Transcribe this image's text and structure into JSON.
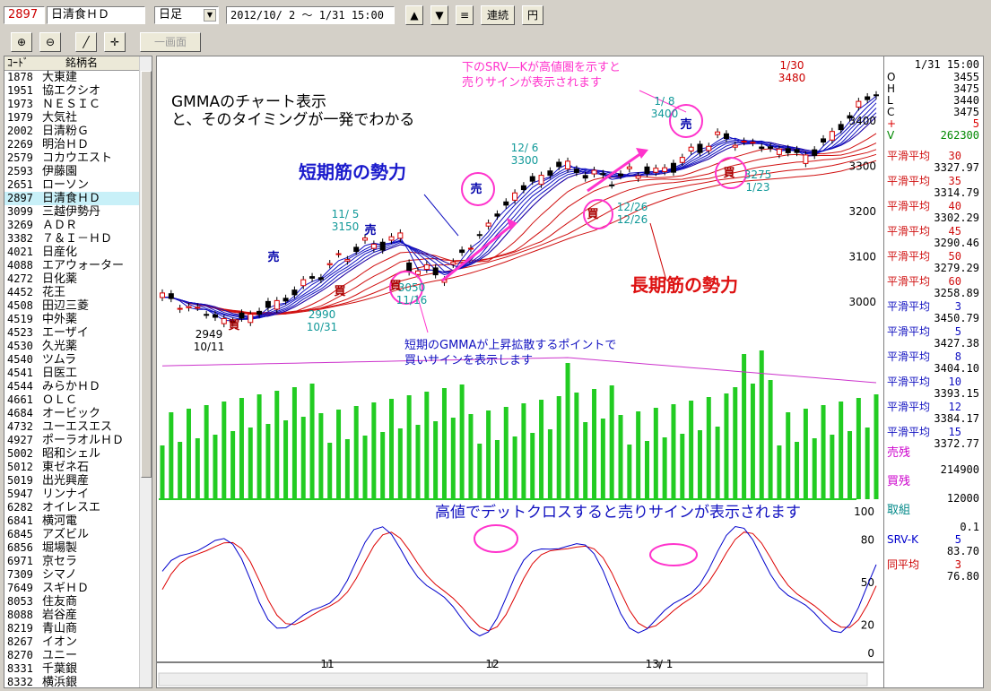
{
  "toolbar": {
    "code": "2897",
    "name": "日清食ＨＤ",
    "period": "日足",
    "range": "2012/10/ 2 ～  1/31 15:00",
    "continuous": "連続",
    "yen": "円",
    "single_screen": "一画面"
  },
  "list": {
    "col_code": "ｺｰﾄﾞ",
    "col_name": "銘柄名",
    "rows": [
      {
        "code": "1878",
        "name": "大東建"
      },
      {
        "code": "1951",
        "name": "協エクシオ"
      },
      {
        "code": "1973",
        "name": "ＮＥＳＩＣ"
      },
      {
        "code": "1979",
        "name": "大気社"
      },
      {
        "code": "2002",
        "name": "日清粉Ｇ"
      },
      {
        "code": "2269",
        "name": "明治ＨＤ"
      },
      {
        "code": "2579",
        "name": "コカウエスト"
      },
      {
        "code": "2593",
        "name": "伊藤園"
      },
      {
        "code": "2651",
        "name": "ローソン"
      },
      {
        "code": "2897",
        "name": "日清食ＨＤ"
      },
      {
        "code": "3099",
        "name": "三越伊勢丹"
      },
      {
        "code": "3269",
        "name": "ＡＤＲ"
      },
      {
        "code": "3382",
        "name": "７＆Ｉ－ＨＤ"
      },
      {
        "code": "4021",
        "name": "日産化"
      },
      {
        "code": "4088",
        "name": "エアウォーター"
      },
      {
        "code": "4272",
        "name": "日化薬"
      },
      {
        "code": "4452",
        "name": "花王"
      },
      {
        "code": "4508",
        "name": "田辺三菱"
      },
      {
        "code": "4519",
        "name": "中外薬"
      },
      {
        "code": "4523",
        "name": "エーザイ"
      },
      {
        "code": "4530",
        "name": "久光薬"
      },
      {
        "code": "4540",
        "name": "ツムラ"
      },
      {
        "code": "4541",
        "name": "日医工"
      },
      {
        "code": "4544",
        "name": "みらかＨＤ"
      },
      {
        "code": "4661",
        "name": "ＯＬＣ"
      },
      {
        "code": "4684",
        "name": "オービック"
      },
      {
        "code": "4732",
        "name": "ユーエスエス"
      },
      {
        "code": "4927",
        "name": "ポーラオルＨＤ"
      },
      {
        "code": "5002",
        "name": "昭和シェル"
      },
      {
        "code": "5012",
        "name": "東ゼネ石"
      },
      {
        "code": "5019",
        "name": "出光興産"
      },
      {
        "code": "5947",
        "name": "リンナイ"
      },
      {
        "code": "6282",
        "name": "オイレスエ"
      },
      {
        "code": "6841",
        "name": "横河電"
      },
      {
        "code": "6845",
        "name": "アズビル"
      },
      {
        "code": "6856",
        "name": "堀場製"
      },
      {
        "code": "6971",
        "name": "京セラ"
      },
      {
        "code": "7309",
        "name": "シマノ"
      },
      {
        "code": "7649",
        "name": "スギＨＤ"
      },
      {
        "code": "8053",
        "name": "住友商"
      },
      {
        "code": "8088",
        "name": "岩谷産"
      },
      {
        "code": "8219",
        "name": "青山商"
      },
      {
        "code": "8267",
        "name": "イオン"
      },
      {
        "code": "8270",
        "name": "ユニー"
      },
      {
        "code": "8331",
        "name": "千葉銀"
      },
      {
        "code": "8332",
        "name": "横浜銀"
      }
    ]
  },
  "chart": {
    "headline_1": "GMMAのチャート表示",
    "headline_2": "と、そのタイミングが一発でわかる",
    "short_label": "短期筋の勢力",
    "long_label": "長期筋の勢力",
    "note_top_1": "下のSRV―Kが高値圏を示すと",
    "note_top_2": "売りサインが表示されます",
    "note_mid_1": "短期のGMMAが上昇拡散するポイントで",
    "note_mid_2": "買いサインを表示します",
    "note_bottom": "高値でデットクロスすると売りサインが表示されます",
    "sell": "売",
    "buy": "買",
    "ann_0131_date": "1/30",
    "ann_0131_val": "3480",
    "ann_18_date": "1/ 8",
    "ann_18_val": "3400",
    "ann_1206_date": "12/ 6",
    "ann_1206_val": "3300",
    "ann_1105_date": "11/ 5",
    "ann_1105_val": "3150",
    "ann_1031_val": "2990",
    "ann_1031_date": "10/31",
    "ann_1011_val": "2949",
    "ann_1011_date": "10/11",
    "ann_1116_val": "3050",
    "ann_1116_date": "11/16",
    "ann_1226_a": "12/26",
    "ann_1226_b": "12/26",
    "ann_123_val": "3275",
    "ann_123_date": "1/23",
    "price_ticks": [
      "3400",
      "3300",
      "3200",
      "3100",
      "3000"
    ],
    "osc_ticks": [
      "100",
      "80",
      "50",
      "20",
      "0"
    ],
    "x_ticks": [
      "11",
      "12",
      "13/ 1"
    ]
  },
  "info": {
    "datetime": "1/31 15:00",
    "ohlc": [
      {
        "l": "O",
        "v": "3455"
      },
      {
        "l": "H",
        "v": "3475"
      },
      {
        "l": "L",
        "v": "3440"
      },
      {
        "l": "C",
        "v": "3475"
      },
      {
        "l": "+",
        "v": "5"
      },
      {
        "l": "V",
        "v": "262300"
      }
    ],
    "long_ma": [
      {
        "l": "平滑平均",
        "n": "30",
        "v": "3327.97"
      },
      {
        "l": "平滑平均",
        "n": "35",
        "v": "3314.79"
      },
      {
        "l": "平滑平均",
        "n": "40",
        "v": "3302.29"
      },
      {
        "l": "平滑平均",
        "n": "45",
        "v": "3290.46"
      },
      {
        "l": "平滑平均",
        "n": "50",
        "v": "3279.29"
      },
      {
        "l": "平滑平均",
        "n": "60",
        "v": "3258.89"
      }
    ],
    "short_ma": [
      {
        "l": "平滑平均",
        "n": "3",
        "v": "3450.79"
      },
      {
        "l": "平滑平均",
        "n": "5",
        "v": "3427.38"
      },
      {
        "l": "平滑平均",
        "n": "8",
        "v": "3404.10"
      },
      {
        "l": "平滑平均",
        "n": "10",
        "v": "3393.15"
      },
      {
        "l": "平滑平均",
        "n": "12",
        "v": "3384.17"
      },
      {
        "l": "平滑平均",
        "n": "15",
        "v": "3372.77"
      }
    ],
    "sell_rem_label": "売残",
    "sell_rem": "214900",
    "buy_rem_label": "買残",
    "buy_rem": "12000",
    "torikumi_label": "取組",
    "torikumi": "0.1",
    "srvk_label": "SRV-K",
    "srvk_n": "5",
    "srvk_v": "83.70",
    "same_avg_label": "同平均",
    "same_avg_n": "3",
    "same_avg_v": "76.80"
  },
  "colors": {
    "short_ma": "#1010c0",
    "long_ma": "#d01010",
    "volume": "#22cc22",
    "annot": "#ff33cc",
    "sell_mark": "#0000aa",
    "buy_mark": "#aa0000"
  }
}
